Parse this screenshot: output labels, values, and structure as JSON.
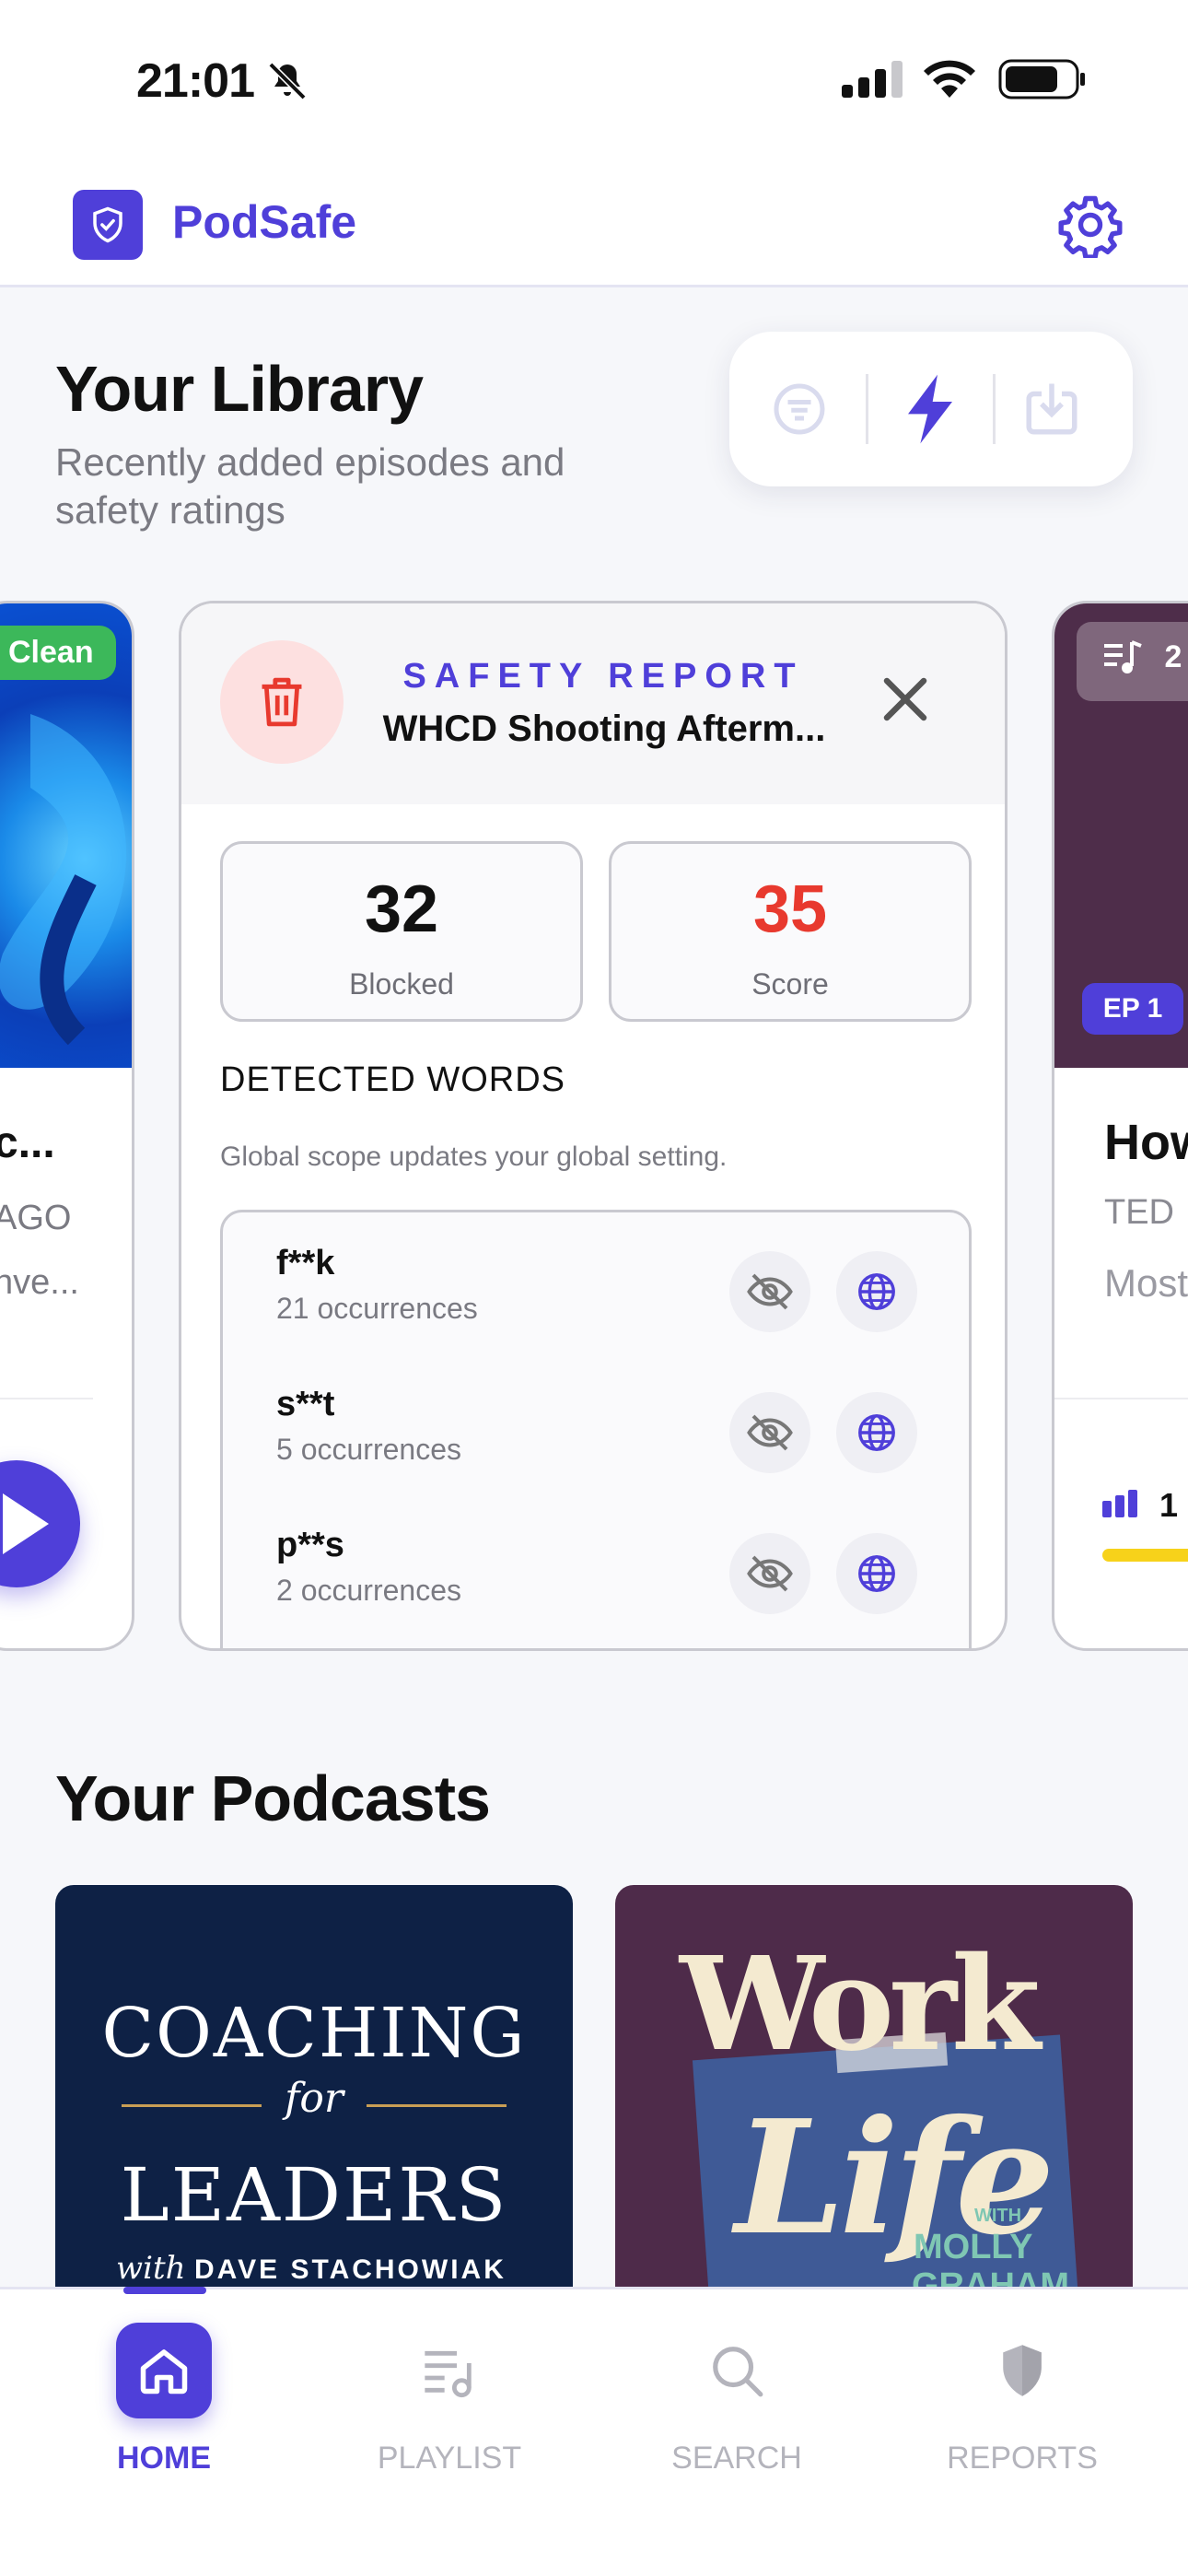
{
  "status_bar": {
    "time": "21:01"
  },
  "header": {
    "app_name": "PodSafe"
  },
  "library": {
    "title": "Your Library",
    "subtitle": "Recently added episodes and safety ratings"
  },
  "left_card": {
    "badge": "Clean",
    "title": "c...",
    "meta": "AGO",
    "desc": "nve..."
  },
  "report": {
    "label": "SAFETY REPORT",
    "episode_title": "WHCD Shooting Afterm...",
    "blocked_value": "32",
    "blocked_label": "Blocked",
    "score_value": "35",
    "score_label": "Score",
    "score_color": "#e8392e",
    "detected_title": "DETECTED WORDS",
    "detected_note": "Global scope updates your global setting.",
    "words": [
      {
        "word": "f**k",
        "count": "21 occurrences"
      },
      {
        "word": "s**t",
        "count": "5 occurrences"
      },
      {
        "word": "p**s",
        "count": "2 occurrences"
      }
    ]
  },
  "right_card": {
    "badge": "2",
    "episode_badge": "EP 1",
    "title": "How",
    "meta": "TED",
    "desc": "Most",
    "stat": "1"
  },
  "podcasts": {
    "title": "Your Podcasts",
    "tiles": [
      {
        "line1": "COACHING",
        "line2": "for",
        "line3": "LEADERS",
        "with": "with",
        "host": "DAVE STACHOWIAK"
      },
      {
        "line1": "Work",
        "line2": "Life",
        "with": "WITH",
        "host1": "MOLLY",
        "host2": "GRAHAM"
      }
    ]
  },
  "tabs": [
    {
      "label": "HOME",
      "icon": "home-icon",
      "active": true
    },
    {
      "label": "PLAYLIST",
      "icon": "playlist-icon",
      "active": false
    },
    {
      "label": "SEARCH",
      "icon": "search-icon",
      "active": false
    },
    {
      "label": "REPORTS",
      "icon": "shield-icon",
      "active": false
    }
  ],
  "colors": {
    "accent": "#4f3fd9",
    "clean": "#3cb85a",
    "danger": "#e8392e"
  }
}
